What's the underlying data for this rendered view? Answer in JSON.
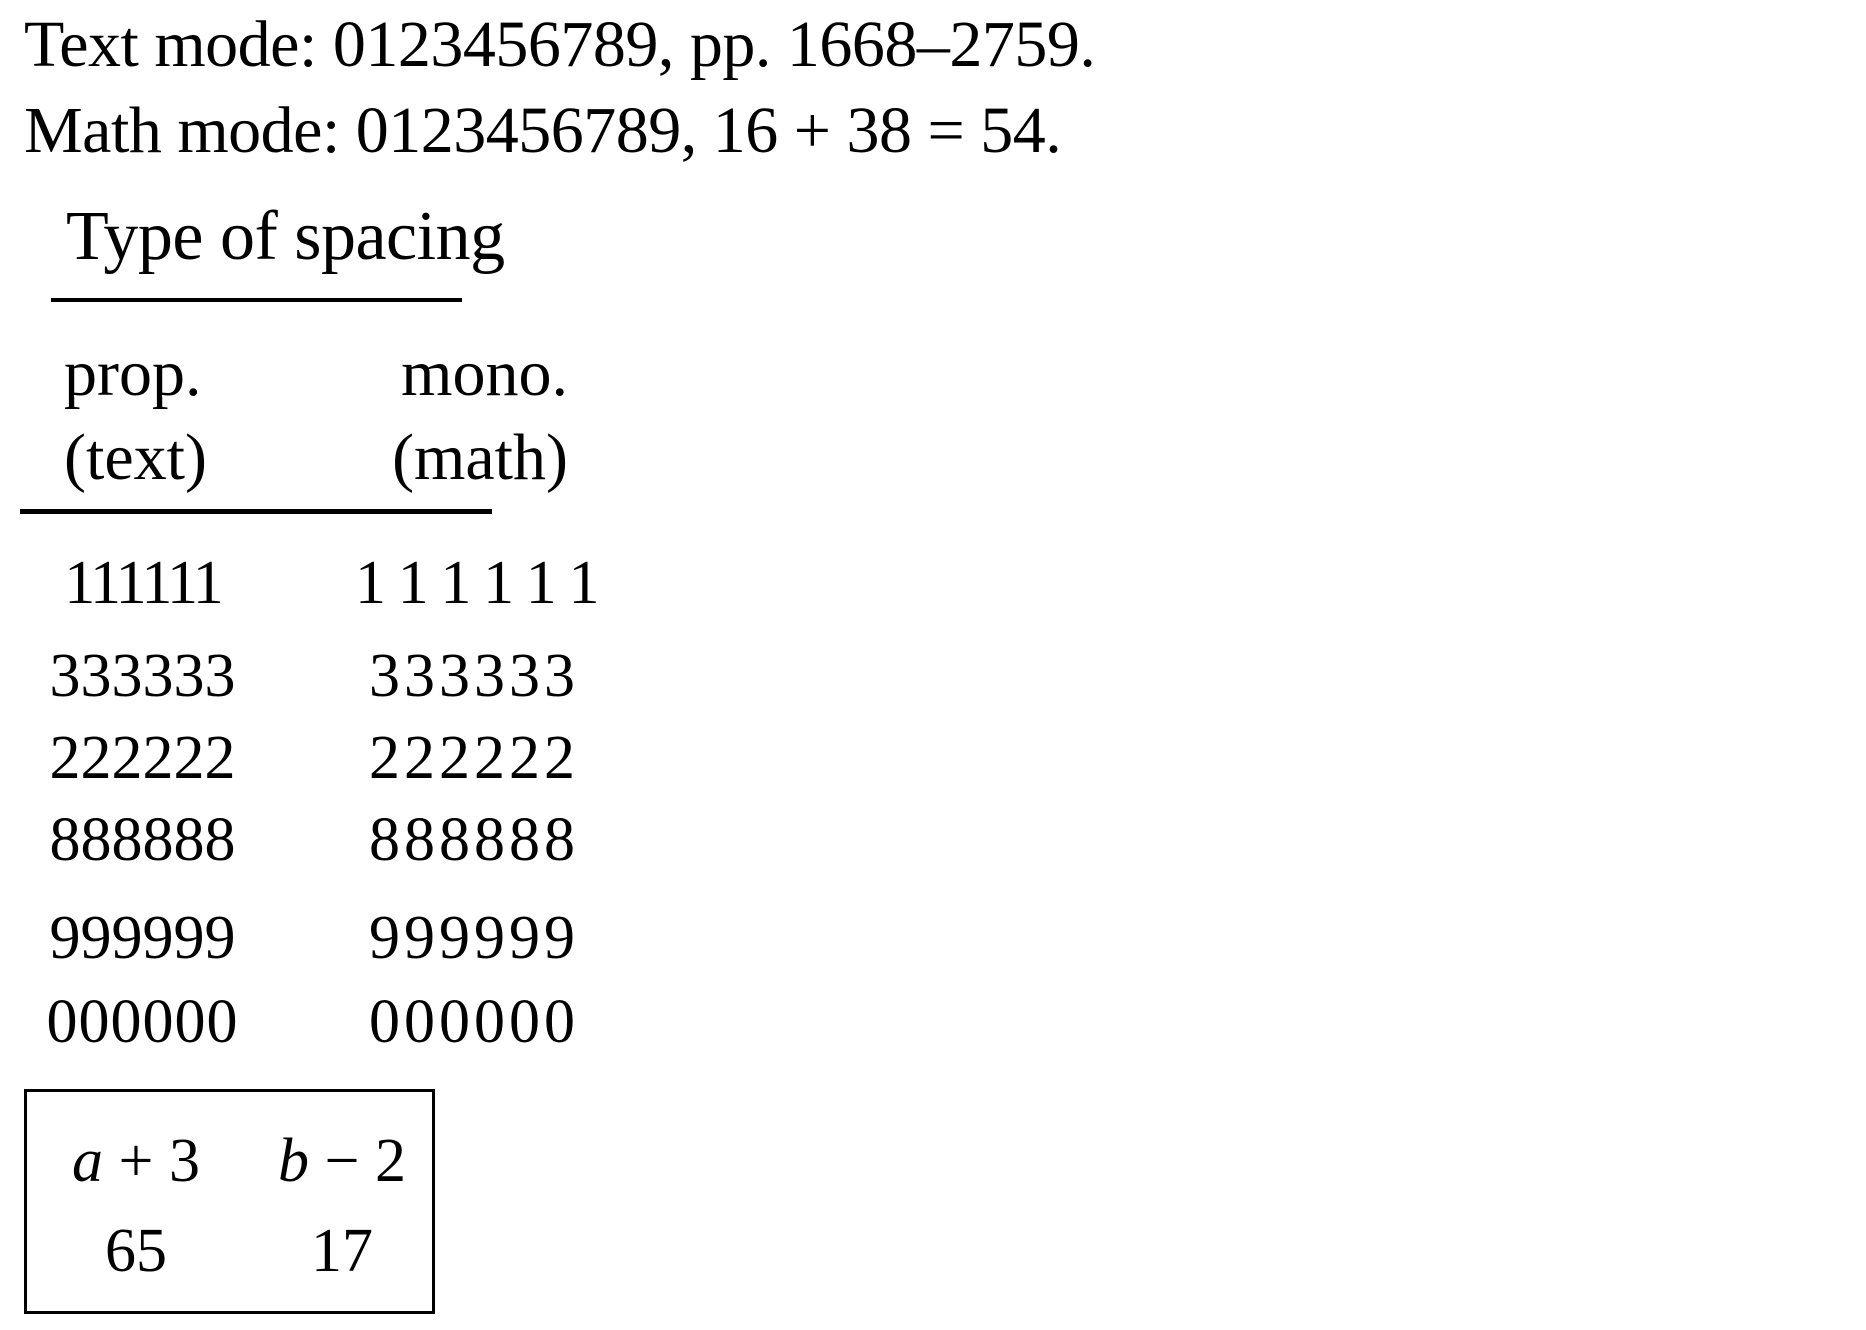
{
  "text_mode": {
    "label": "Text mode:",
    "digits": "0123456789,",
    "pages": "pp. 1668–2759."
  },
  "math_mode": {
    "label": "Math mode:",
    "digits": "0123456789,",
    "equation": "16 + 38 = 54."
  },
  "spacing_table": {
    "title": "Type of spacing",
    "columns": [
      {
        "line1": "prop.",
        "line2": "(text)"
      },
      {
        "line1": "mono.",
        "line2": "(math)"
      }
    ],
    "rows": [
      {
        "prop": "111111",
        "mono": "111111"
      },
      {
        "prop": "333333",
        "mono": "333333"
      },
      {
        "prop": "222222",
        "mono": "222222"
      },
      {
        "prop": "888888",
        "mono": "888888"
      },
      {
        "prop": "999999",
        "mono": "999999"
      },
      {
        "prop": "000000",
        "mono": "000000"
      }
    ]
  },
  "boxed_table": {
    "expressions": [
      {
        "var": "a",
        "op": "+",
        "num": "3"
      },
      {
        "var": "b",
        "op": "−",
        "num": "2"
      }
    ],
    "values": [
      "65",
      "17"
    ]
  }
}
